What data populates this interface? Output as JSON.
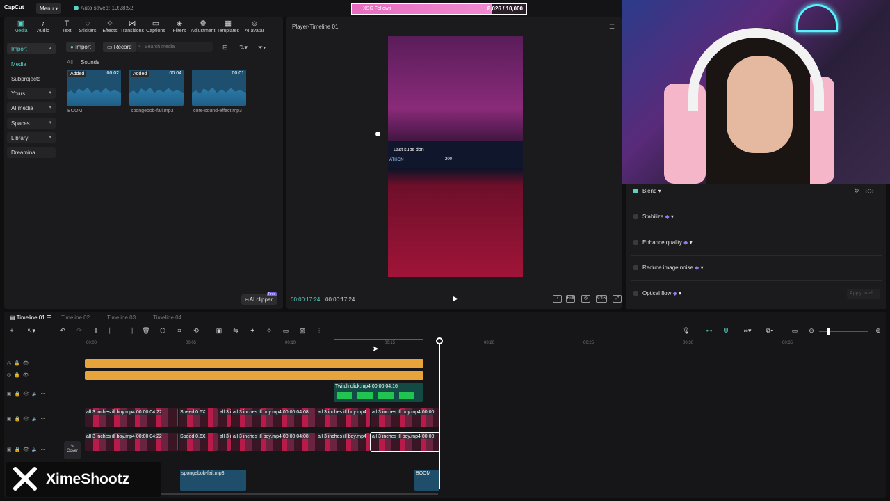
{
  "topbar": {
    "brand": "CapCut",
    "menu_label": "Menu",
    "autosave": "Auto saved: 19:28:52"
  },
  "follow_goal": {
    "label": "XSG Follows",
    "value": "8,026 / 10,000",
    "progress_fraction": 0.8026,
    "color": "#e86cc0"
  },
  "toolbar": {
    "items": [
      {
        "label": "Media",
        "icon": "media-icon"
      },
      {
        "label": "Audio",
        "icon": "audio-icon"
      },
      {
        "label": "Text",
        "icon": "text-icon"
      },
      {
        "label": "Stickers",
        "icon": "sticker-icon"
      },
      {
        "label": "Effects",
        "icon": "effects-icon"
      },
      {
        "label": "Transitions",
        "icon": "transitions-icon"
      },
      {
        "label": "Captions",
        "icon": "captions-icon"
      },
      {
        "label": "Filters",
        "icon": "filters-icon"
      },
      {
        "label": "Adjustment",
        "icon": "adjustment-icon"
      },
      {
        "label": "Templates",
        "icon": "templates-icon"
      },
      {
        "label": "AI avatar",
        "icon": "ai-avatar-icon"
      }
    ]
  },
  "sidebar": {
    "items": [
      {
        "label": "Import"
      },
      {
        "label": "Media"
      },
      {
        "label": "Subprojects"
      },
      {
        "label": "Yours"
      },
      {
        "label": "AI media"
      },
      {
        "label": "Spaces"
      },
      {
        "label": "Library"
      },
      {
        "label": "Dreamina"
      }
    ]
  },
  "media": {
    "import_label": "Import",
    "record_label": "Record",
    "search_placeholder": "Search media",
    "filter_all": "All",
    "filter_sounds": "Sounds",
    "items": [
      {
        "name": "BOOM",
        "duration": "00:02",
        "badge": "Added"
      },
      {
        "name": "spongebob-fail.mp3",
        "duration": "00:04",
        "badge": "Added"
      },
      {
        "name": "core-sound-effect.mp3",
        "duration": "00:01",
        "badge": ""
      }
    ],
    "ai_clipper": "AI clipper",
    "free_badge": "Free"
  },
  "player": {
    "title": "Player-Timeline 01",
    "current_time": "00:00:17:24",
    "total_time": "00:00:17:24",
    "overlay_text": "Last subs don",
    "overlay_sub": "ATHON",
    "overlay_num": "200",
    "ctl_full": "Full",
    "ctl_ratio": "9:16"
  },
  "properties": {
    "items": [
      {
        "label": "Blend",
        "checked": true
      },
      {
        "label": "Stabilize",
        "checked": false
      },
      {
        "label": "Enhance quality",
        "checked": false
      },
      {
        "label": "Reduce image noise",
        "checked": false
      },
      {
        "label": "Optical flow",
        "checked": false
      }
    ],
    "apply_all": "Apply to all",
    "accent": "#5bd1c6"
  },
  "timeline": {
    "tabs": [
      "Timeline 01",
      "Timeline 02",
      "Timeline 03",
      "Timeline 04"
    ],
    "ruler": [
      "00:00",
      "00:05",
      "00:10",
      "00:15",
      "00:20",
      "00:25",
      "00:30",
      "00:35"
    ],
    "twitch_clip": "Twitch click.mp4  00:00:04:16",
    "video_track1": [
      "all 3 inches ill boy.mp4  00:00:04:22",
      "Speed 0.6X",
      "all 3 i",
      "all 3 inches ill boy.mp4  00:00:04:08",
      "all 3 inches ill boy.mp4",
      "all 3 inches ill boy.mp4",
      "00:00:"
    ],
    "video_track2": [
      "all 3 inches ill boy.mp4  00:00:04:22",
      "Speed 0.6X",
      "all 3 i",
      "all 3 inches ill boy.mp4  00:00:04:08",
      "all 3 inches ill boy.mp4",
      "all 3 inches ill boy.mp4",
      "00:00:"
    ],
    "cover_label": "Cover",
    "audio_clips": [
      "spongebob-fail.mp3",
      "BOOM"
    ]
  },
  "watermark": {
    "name": "XimeShootz"
  }
}
